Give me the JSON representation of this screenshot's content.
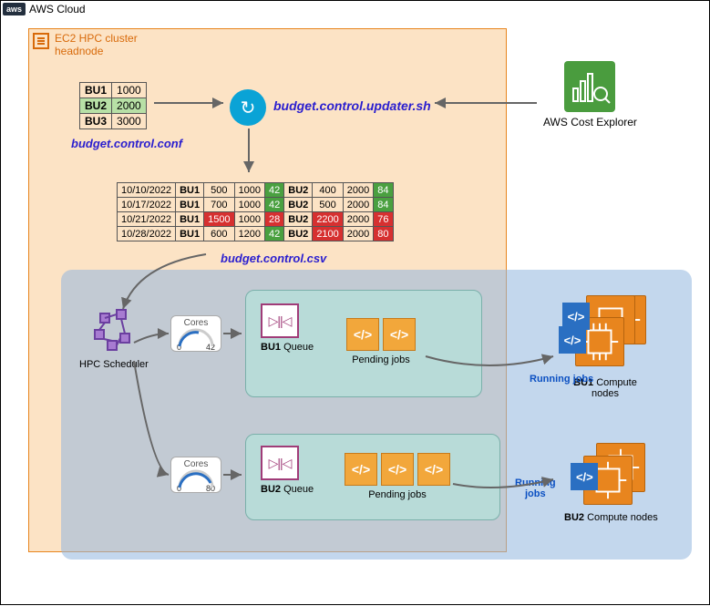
{
  "cloud": {
    "badge": "aws",
    "label": "AWS Cloud"
  },
  "headnode": {
    "title_l1": "EC2 HPC cluster",
    "title_l2": "headnode"
  },
  "conf": {
    "rows": [
      {
        "bu": "BU1",
        "val": "1000"
      },
      {
        "bu": "BU2",
        "val": "2000"
      },
      {
        "bu": "BU3",
        "val": "3000"
      }
    ],
    "label": "budget.control.conf"
  },
  "updater": {
    "label": "budget.control.updater.sh"
  },
  "cost_explorer": {
    "label": "AWS Cost Explorer"
  },
  "csv": {
    "rows": [
      {
        "date": "10/10/2022",
        "bu1": "BU1",
        "a1": "500",
        "a1_red": false,
        "b1": "1000",
        "c1": "42",
        "c1_red": false,
        "bu2": "BU2",
        "a2": "400",
        "a2_red": false,
        "b2": "2000",
        "c2": "84",
        "c2_red": false
      },
      {
        "date": "10/17/2022",
        "bu1": "BU1",
        "a1": "700",
        "a1_red": false,
        "b1": "1000",
        "c1": "42",
        "c1_red": false,
        "bu2": "BU2",
        "a2": "500",
        "a2_red": false,
        "b2": "2000",
        "c2": "84",
        "c2_red": false
      },
      {
        "date": "10/21/2022",
        "bu1": "BU1",
        "a1": "1500",
        "a1_red": true,
        "b1": "1000",
        "c1": "28",
        "c1_red": true,
        "bu2": "BU2",
        "a2": "2200",
        "a2_red": true,
        "b2": "2000",
        "c2": "76",
        "c2_red": true
      },
      {
        "date": "10/28/2022",
        "bu1": "BU1",
        "a1": "600",
        "a1_red": false,
        "b1": "1200",
        "c1": "42",
        "c1_red": false,
        "bu2": "BU2",
        "a2": "2100",
        "a2_red": true,
        "b2": "2000",
        "c2": "80",
        "c2_red": true
      }
    ],
    "label": "budget.control.csv"
  },
  "scheduler": {
    "label": "HPC Scheduler"
  },
  "gauges": {
    "g1": {
      "title": "Cores",
      "min": "0",
      "max": "42"
    },
    "g2": {
      "title": "Cores",
      "min": "0",
      "max": "80"
    }
  },
  "queues": {
    "q1": {
      "bu": "BU1",
      "label_suffix": " Queue",
      "pending_label": "Pending jobs"
    },
    "q2": {
      "bu": "BU2",
      "label_suffix": " Queue",
      "pending_label": "Pending jobs"
    }
  },
  "running": {
    "label": "Running jobs",
    "label2_l1": "Running",
    "label2_l2": "jobs"
  },
  "compute": {
    "c1": {
      "bu": "BU1",
      "suffix_l1": " Compute",
      "suffix_l2": "nodes"
    },
    "c2": {
      "bu": "BU2",
      "suffix": " Compute nodes"
    }
  },
  "glyphs": {
    "code": "</>",
    "queue": "▷||◁"
  }
}
